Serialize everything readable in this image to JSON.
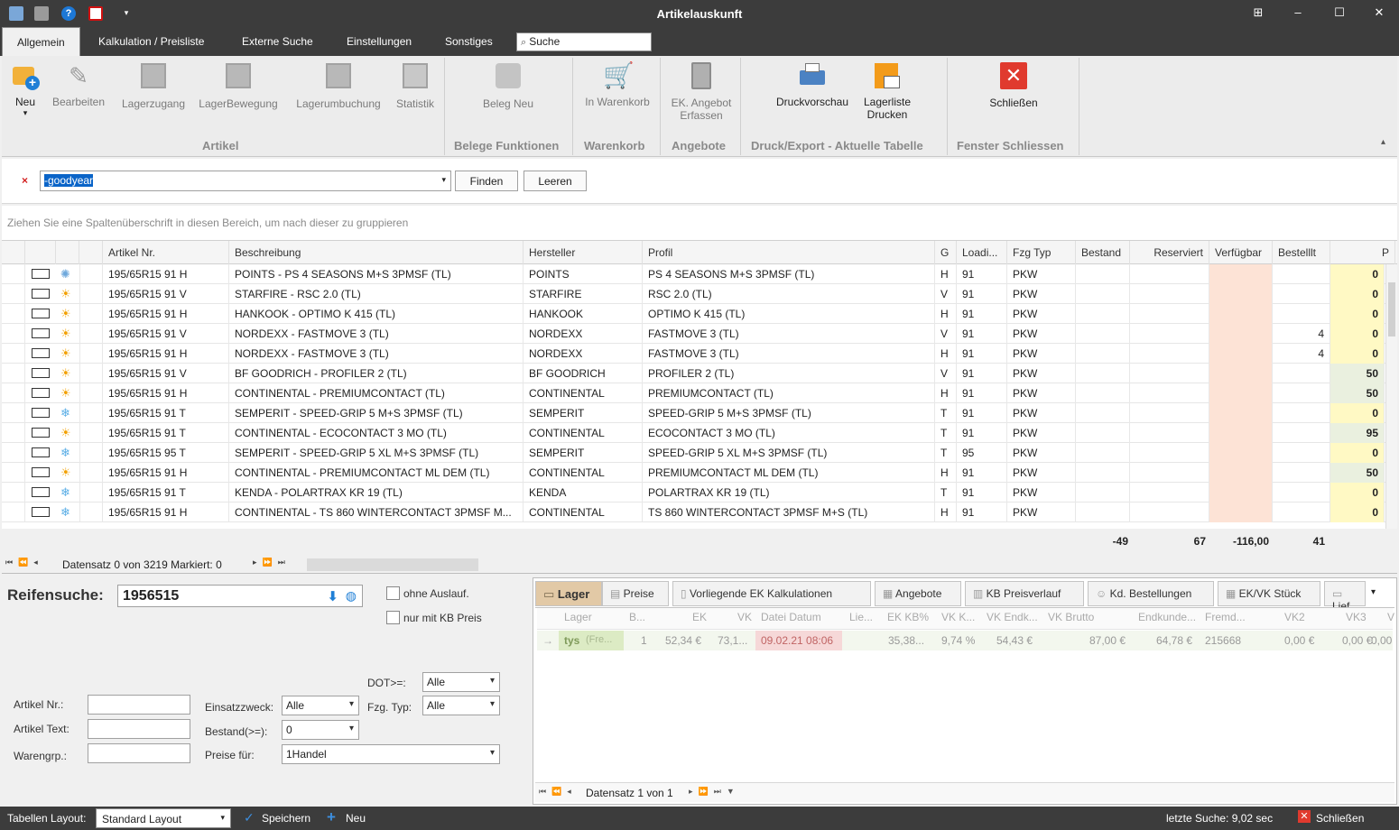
{
  "window": {
    "title": "Artikelauskunft"
  },
  "menu": {
    "tabs": [
      "Allgemein",
      "Kalkulation / Preisliste",
      "Externe Suche",
      "Einstellungen",
      "Sonstiges"
    ],
    "search_placeholder": "Suche"
  },
  "ribbon": {
    "buttons": [
      "Neu",
      "Bearbeiten",
      "Lagerzugang",
      "LagerBewegung",
      "Lagerumbuchung",
      "Statistik",
      "Beleg Neu",
      "In Warenkorb",
      "EK. Angebot",
      "Erfassen",
      "Druckvorschau",
      "Lagerliste",
      "Drucken",
      "Schließen"
    ],
    "groups": [
      "Artikel",
      "Belege Funktionen",
      "Warenkorb",
      "Angebote",
      "Druck/Export - Aktuelle Tabelle",
      "Fenster Schliessen"
    ]
  },
  "search": {
    "value": "-goodyear",
    "find": "Finden",
    "clear": "Leeren"
  },
  "group_hint": "Ziehen Sie eine Spaltenüberschrift in diesen Bereich, um nach dieser zu gruppieren",
  "grid": {
    "columns": [
      "Artikel Nr.",
      "Beschreibung",
      "Hersteller",
      "Profil",
      "G",
      "Loadi...",
      "Fzg Typ",
      "Bestand",
      "Reserviert",
      "Verfügbar",
      "Bestelllt",
      "P"
    ],
    "rows": [
      {
        "season": "allseason",
        "art": "195/65R15 91 H",
        "desc": "POINTS - PS 4 SEASONS M+S 3PMSF (TL)",
        "hersteller": "POINTS",
        "profil": "PS 4 SEASONS M+S 3PMSF (TL)",
        "g": "H",
        "load": "91",
        "fzg": "PKW",
        "bestellt": "",
        "p": "0"
      },
      {
        "season": "sun",
        "art": "195/65R15 91 V",
        "desc": "STARFIRE - RSC 2.0 (TL)",
        "hersteller": "STARFIRE",
        "profil": "RSC 2.0 (TL)",
        "g": "V",
        "load": "91",
        "fzg": "PKW",
        "bestellt": "",
        "p": "0"
      },
      {
        "season": "sun",
        "art": "195/65R15 91 H",
        "desc": "HANKOOK - OPTIMO K 415 (TL)",
        "hersteller": "HANKOOK",
        "profil": "OPTIMO K 415 (TL)",
        "g": "H",
        "load": "91",
        "fzg": "PKW",
        "bestellt": "",
        "p": "0"
      },
      {
        "season": "sun",
        "art": "195/65R15 91 V",
        "desc": "NORDEXX - FASTMOVE 3 (TL)",
        "hersteller": "NORDEXX",
        "profil": "FASTMOVE 3 (TL)",
        "g": "V",
        "load": "91",
        "fzg": "PKW",
        "bestellt": "4",
        "p": "0"
      },
      {
        "season": "sun",
        "art": "195/65R15 91 H",
        "desc": "NORDEXX - FASTMOVE 3 (TL)",
        "hersteller": "NORDEXX",
        "profil": "FASTMOVE 3 (TL)",
        "g": "H",
        "load": "91",
        "fzg": "PKW",
        "bestellt": "4",
        "p": "0"
      },
      {
        "season": "sun",
        "art": "195/65R15 91 V",
        "desc": "BF GOODRICH - PROFILER 2 (TL)",
        "hersteller": "BF GOODRICH",
        "profil": "PROFILER 2 (TL)",
        "g": "V",
        "load": "91",
        "fzg": "PKW",
        "bestellt": "",
        "p": "50"
      },
      {
        "season": "sun",
        "art": "195/65R15 91 H",
        "desc": "CONTINENTAL - PREMIUMCONTACT (TL)",
        "hersteller": "CONTINENTAL",
        "profil": "PREMIUMCONTACT (TL)",
        "g": "H",
        "load": "91",
        "fzg": "PKW",
        "bestellt": "",
        "p": "50"
      },
      {
        "season": "snow",
        "art": "195/65R15 91 T",
        "desc": "SEMPERIT - SPEED-GRIP 5 M+S 3PMSF (TL)",
        "hersteller": "SEMPERIT",
        "profil": "SPEED-GRIP 5 M+S 3PMSF (TL)",
        "g": "T",
        "load": "91",
        "fzg": "PKW",
        "bestellt": "",
        "p": "0"
      },
      {
        "season": "sun",
        "art": "195/65R15 91 T",
        "desc": "CONTINENTAL - ECOCONTACT 3 MO (TL)",
        "hersteller": "CONTINENTAL",
        "profil": "ECOCONTACT 3 MO (TL)",
        "g": "T",
        "load": "91",
        "fzg": "PKW",
        "bestellt": "",
        "p": "95"
      },
      {
        "season": "snow",
        "art": "195/65R15 95 T",
        "desc": "SEMPERIT - SPEED-GRIP 5 XL M+S 3PMSF (TL)",
        "hersteller": "SEMPERIT",
        "profil": "SPEED-GRIP 5 XL M+S 3PMSF (TL)",
        "g": "T",
        "load": "95",
        "fzg": "PKW",
        "bestellt": "",
        "p": "0"
      },
      {
        "season": "sun",
        "art": "195/65R15 91 H",
        "desc": "CONTINENTAL - PREMIUMCONTACT ML DEM (TL)",
        "hersteller": "CONTINENTAL",
        "profil": "PREMIUMCONTACT ML DEM (TL)",
        "g": "H",
        "load": "91",
        "fzg": "PKW",
        "bestellt": "",
        "p": "50"
      },
      {
        "season": "snow",
        "art": "195/65R15 91 T",
        "desc": "KENDA - POLARTRAX KR 19 (TL)",
        "hersteller": "KENDA",
        "profil": "POLARTRAX KR 19 (TL)",
        "g": "T",
        "load": "91",
        "fzg": "PKW",
        "bestellt": "",
        "p": "0"
      },
      {
        "season": "snow",
        "art": "195/65R15 91 H",
        "desc": "CONTINENTAL - TS 860 WINTERCONTACT 3PMSF M...",
        "hersteller": "CONTINENTAL",
        "profil": "TS 860 WINTERCONTACT 3PMSF M+S (TL)",
        "g": "H",
        "load": "91",
        "fzg": "PKW",
        "bestellt": "",
        "p": "0"
      }
    ],
    "totals": {
      "bestand": "-49",
      "reserviert": "67",
      "verfuegbar": "-116,00",
      "bestellt": "41"
    },
    "nav_text": "Datensatz 0 von 3219 Markiert: 0"
  },
  "reifensuche": {
    "label": "Reifensuche:",
    "value": "1956515",
    "ohne_auslauf": "ohne Auslauf.",
    "nur_kb": "nur mit KB Preis",
    "dot_label": "DOT>=:",
    "dot_value": "Alle",
    "artikel_nr": "Artikel Nr.:",
    "artikel_text": "Artikel Text:",
    "warengrp": "Warengrp.:",
    "einsatz_label": "Einsatzzweck:",
    "einsatz_value": "Alle",
    "fzg_label": "Fzg. Typ:",
    "fzg_value": "Alle",
    "bestand_label": "Bestand(>=):",
    "bestand_value": "0",
    "preise_label": "Preise für:",
    "preise_value": "1Handel"
  },
  "detail": {
    "tabs": [
      "Lager",
      "Preise",
      "Vorliegende EK Kalkulationen",
      "Angebote",
      "KB Preisverlauf",
      "Kd. Bestellungen",
      "EK/VK Stück",
      "Lief"
    ],
    "headers": [
      "Lager",
      "B...",
      "EK",
      "VK",
      "Datei Datum",
      "Lie...",
      "EK KB%",
      "VK K...",
      "VK Endk...",
      "VK Brutto",
      "Endkunde...",
      "Fremd...",
      "VK2",
      "VK3",
      "V"
    ],
    "row": {
      "lager": "tys",
      "lager_sub": "(Fre...",
      "b": "1",
      "ek": "52,34 €",
      "vk": "73,1...",
      "datum": "09.02.21 08:06",
      "lie": "",
      "ekkb": "35,38...",
      "vkk": "9,74 %",
      "vkendk": "54,43 €",
      "vkbrutto": "87,00 €",
      "endkunde": "64,78 €",
      "fremd": "215668",
      "vk2": "0,00 €",
      "vk3": "0,00 €",
      "v": "0,00"
    },
    "nav_text": "Datensatz 1 von 1"
  },
  "status": {
    "layout_label": "Tabellen Layout:",
    "layout_value": "Standard Layout",
    "save": "Speichern",
    "new": "Neu",
    "last_search": "letzte Suche: 9,02 sec",
    "close": "Schließen"
  }
}
